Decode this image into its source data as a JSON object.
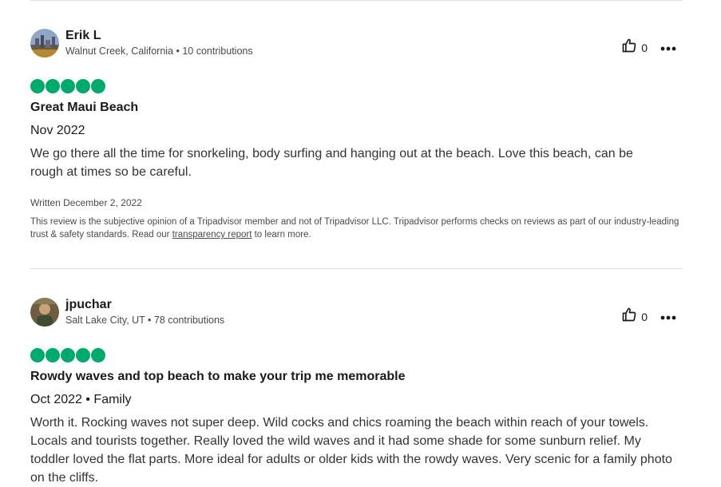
{
  "reviews": [
    {
      "user": {
        "name": "Erik L",
        "location": "Walnut Creek, California",
        "contributions": "10 contributions"
      },
      "likes": "0",
      "rating": 5,
      "title": "Great Maui Beach",
      "date_trip": "Nov 2022",
      "text": "We go there all the time for snorkeling, body surfing and hanging out at the beach. Love this beach, can be rough at times so be careful.",
      "written": "Written December 2, 2022",
      "disclaimer_before": "This review is the subjective opinion of a Tripadvisor member and not of Tripadvisor LLC. Tripadvisor performs checks on reviews as part of our industry-leading trust & safety standards. Read our ",
      "disclaimer_link": "transparency report",
      "disclaimer_after": " to learn more."
    },
    {
      "user": {
        "name": "jpuchar",
        "location": "Salt Lake City, UT",
        "contributions": "78 contributions"
      },
      "likes": "0",
      "rating": 5,
      "title": "Rowdy waves and top beach to make your trip me memorable",
      "date_trip": "Oct 2022 • Family",
      "text": "Worth it. Rocking waves not super deep. Wild cocks and chics roaming the beach within reach of your towels. Locals and tourists together. Really loved the wild waves and it had some shade for some sunburn relief. My toddler loved the flat parts. More ideal for adults or older kids with the rowdy waves. Very scenic for a family photo on the cliffs."
    }
  ],
  "separator": " • ",
  "colors": {
    "rating_bubble": "#00aa6c",
    "divider": "#e0e0e0"
  },
  "icons": {
    "like": "thumbs-up-icon",
    "more": "more-options-icon"
  }
}
